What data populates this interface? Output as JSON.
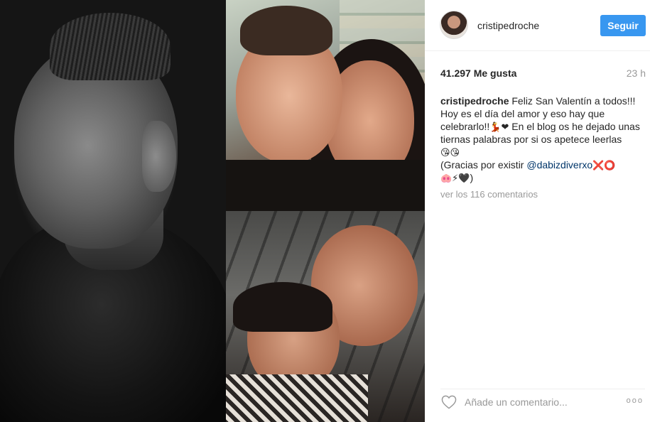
{
  "post": {
    "username": "cristipedroche",
    "follow_label": "Seguir",
    "likes": "41.297 Me gusta",
    "time": "23 h",
    "caption": {
      "author": "cristipedroche",
      "text_1": "Feliz San Valentín a todos!!! Hoy es el día del amor y eso hay que celebrarlo!!",
      "emoji_1": "💃❤",
      "text_2": " En el blog os he dejado unas tiernas palabras por si os apetece leerlas ",
      "emoji_2": "😘😘",
      "text_3": "(Gracias por existir ",
      "mention": "@dabizdiverxo",
      "emoji_3": " ❌⭕",
      "emoji_4": "🐽⚡🖤",
      "text_4": ")"
    },
    "view_comments": "ver los 116 comentarios",
    "comment_placeholder": "Añade un comentario...",
    "more_label": "ooo"
  },
  "colors": {
    "follow_button": "#3897f0",
    "mention": "#003569",
    "muted_text": "#999999"
  },
  "icons": {
    "like": "heart-outline-icon",
    "more": "more-options-icon"
  }
}
